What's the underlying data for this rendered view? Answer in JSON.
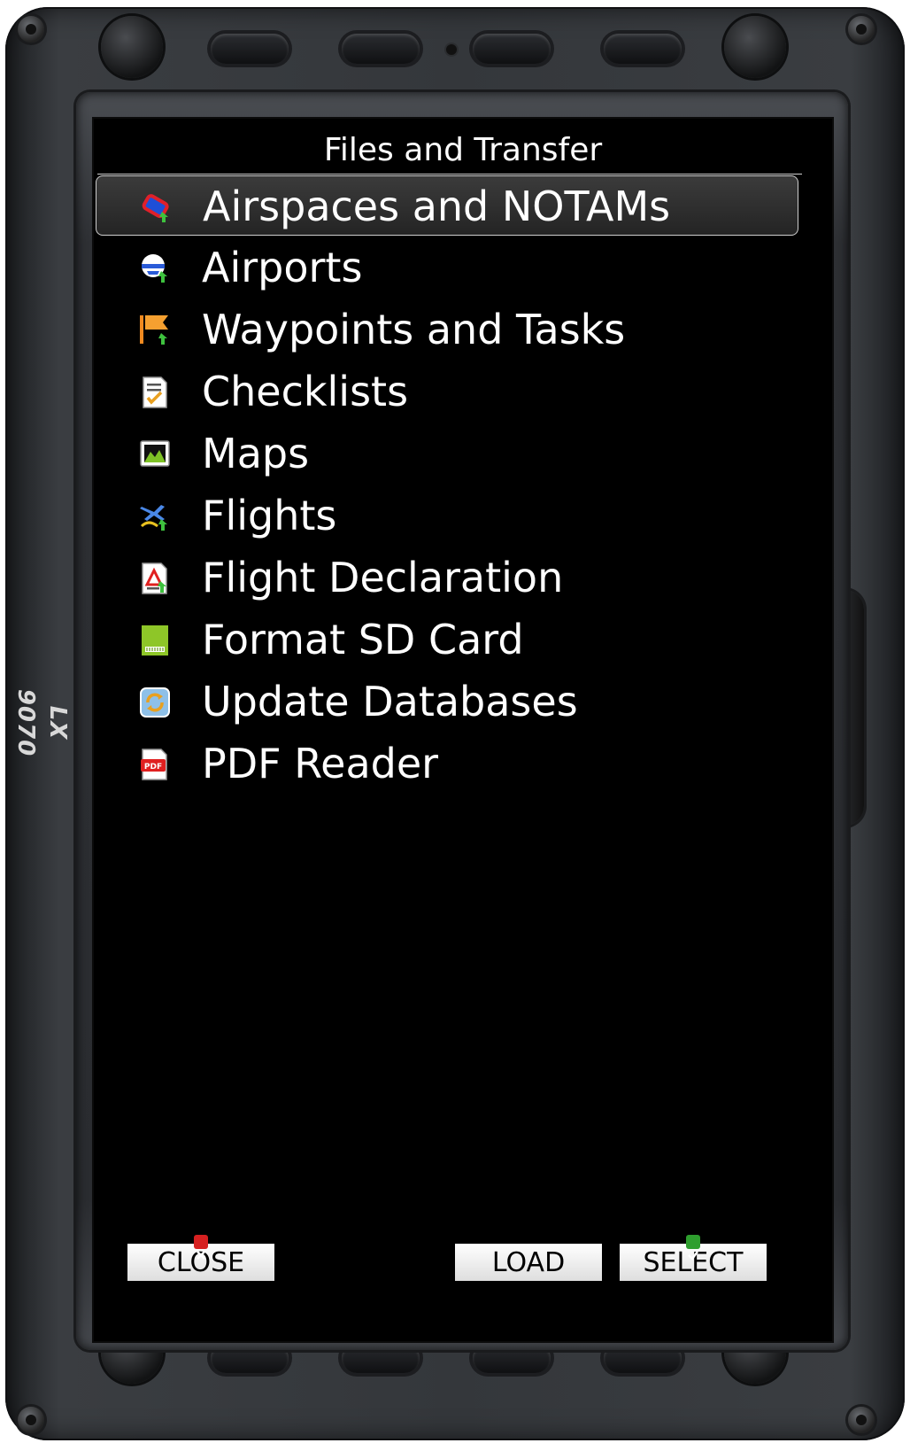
{
  "device": {
    "brand": "LX 9070"
  },
  "screen": {
    "title": "Files and Transfer",
    "menu": [
      {
        "label": "Airspaces and NOTAMs",
        "icon": "airspace-icon",
        "selected": true
      },
      {
        "label": "Airports",
        "icon": "airport-icon",
        "selected": false
      },
      {
        "label": "Waypoints and Tasks",
        "icon": "waypoint-flag-icon",
        "selected": false
      },
      {
        "label": "Checklists",
        "icon": "checklist-icon",
        "selected": false
      },
      {
        "label": "Maps",
        "icon": "map-icon",
        "selected": false
      },
      {
        "label": "Flights",
        "icon": "flights-icon",
        "selected": false
      },
      {
        "label": "Flight Declaration",
        "icon": "flight-declaration-icon",
        "selected": false
      },
      {
        "label": "Format SD Card",
        "icon": "sd-card-icon",
        "selected": false
      },
      {
        "label": "Update Databases",
        "icon": "update-databases-icon",
        "selected": false
      },
      {
        "label": "PDF Reader",
        "icon": "pdf-icon",
        "selected": false
      }
    ]
  },
  "softkeys": {
    "close": {
      "label": "CLOSE",
      "badge": "close-badge-icon",
      "badge_color": "#d62020"
    },
    "load": {
      "label": "LOAD"
    },
    "select": {
      "label": "SELECT",
      "badge": "check-badge-icon",
      "badge_color": "#2e9e2e"
    }
  },
  "colors": {
    "screen_bg": "#000000",
    "text": "#ffffff",
    "selection_border": "#cfcfcf",
    "softkey_bg": "#ffffff"
  }
}
